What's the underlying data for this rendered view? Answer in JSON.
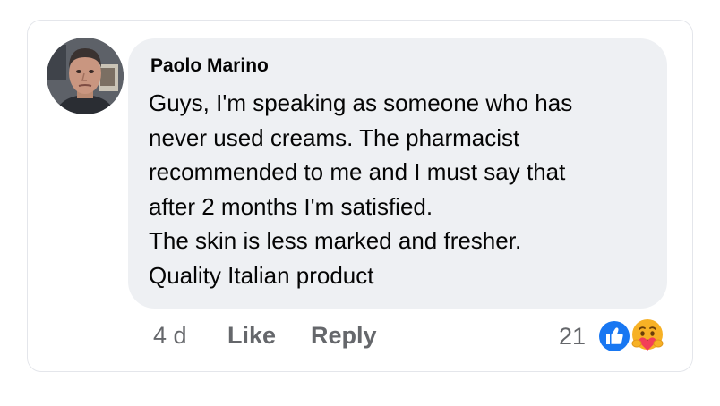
{
  "comment": {
    "author": "Paolo Marino",
    "text_lines": [
      "Guys, I'm speaking as someone who has",
      "never used creams. The pharmacist",
      "recommended to me and I must say that",
      "after 2 months I'm satisfied.",
      "The skin is less marked and fresher.",
      "Quality Italian product"
    ]
  },
  "actions": {
    "time": "4 d",
    "like_label": "Like",
    "reply_label": "Reply"
  },
  "reactions": {
    "count": "21",
    "icons": [
      "like-icon",
      "care-icon"
    ]
  },
  "colors": {
    "bubble": "#eef0f3",
    "text": "#050505",
    "secondary_text": "#65676b",
    "like_blue": "#1877f2",
    "care_yellow": "#f7b125",
    "care_heart": "#f33e58"
  }
}
